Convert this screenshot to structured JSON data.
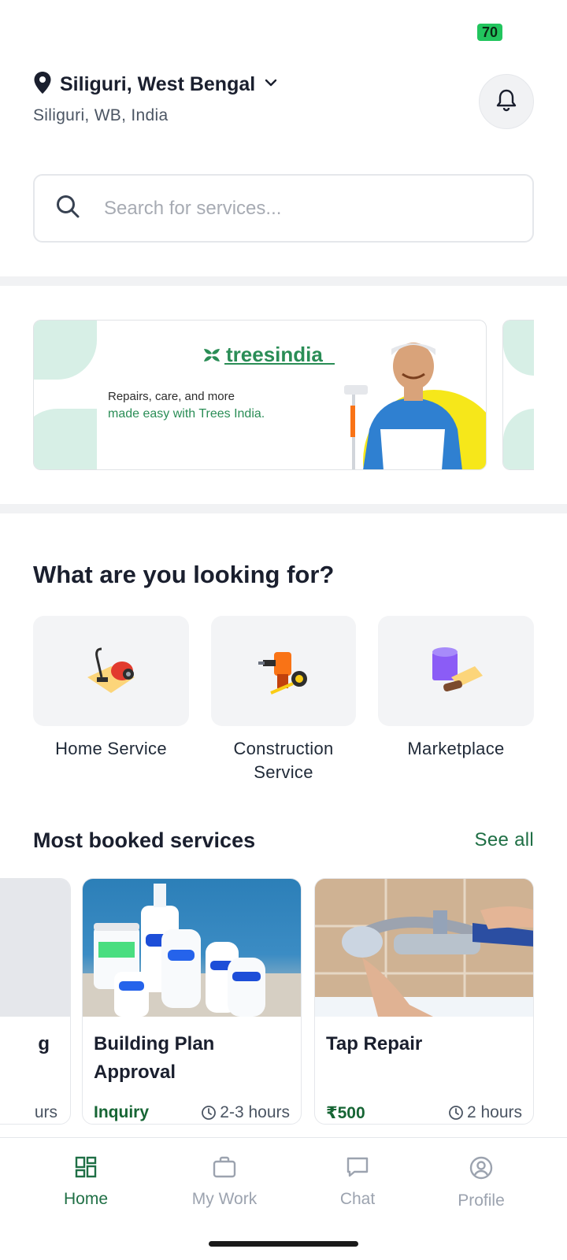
{
  "status": {
    "battery": "70"
  },
  "location": {
    "title": "Siliguri, West Bengal",
    "subtitle": "Siliguri, WB, India"
  },
  "search": {
    "placeholder": "Search for services..."
  },
  "banner": {
    "brand": "treesindia",
    "tagline_1": "Repairs, care, and more",
    "tagline_2": "made easy with Trees India."
  },
  "categories_section": {
    "title": "What are you looking for?",
    "items": [
      {
        "label": "Home Service",
        "icon": "vacuum-icon"
      },
      {
        "label": "Construction Service",
        "icon": "drill-icon"
      },
      {
        "label": "Marketplace",
        "icon": "paint-icon"
      }
    ]
  },
  "most_booked": {
    "title": "Most booked services",
    "see_all": "See all",
    "cards": [
      {
        "title_partial": "g",
        "time_partial": "urs"
      },
      {
        "title": "Building Plan Approval",
        "price": "Inquiry",
        "time": "2-3 hours"
      },
      {
        "title": "Tap Repair",
        "price": "₹500",
        "time": "2 hours"
      }
    ]
  },
  "bottom_nav": [
    {
      "label": "Home",
      "icon": "grid-icon",
      "active": true
    },
    {
      "label": "My Work",
      "icon": "briefcase-icon",
      "active": false
    },
    {
      "label": "Chat",
      "icon": "chat-icon",
      "active": false
    },
    {
      "label": "Profile",
      "icon": "user-icon",
      "active": false
    }
  ],
  "colors": {
    "accent": "#1f6f45",
    "brand_green": "#2a8d56",
    "battery": "#22c55e"
  }
}
